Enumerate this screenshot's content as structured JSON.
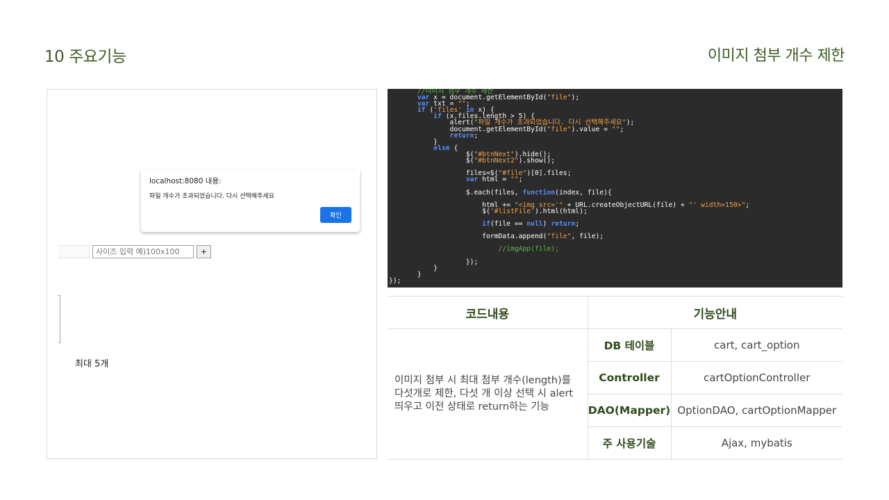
{
  "header": {
    "section_title": "10 주요기능",
    "feature_title": "이미지 첨부 개수 제한"
  },
  "screenshot": {
    "dialog_title": "localhost:8080 내용:",
    "dialog_message": "파일 개수가 초과되었습니다. 다시 선택해주세요",
    "dialog_ok": "확인",
    "size_placeholder": "사이즈 입력 예)100x100",
    "plus_label": "+",
    "max_count": "최대 5개"
  },
  "table": {
    "col_code": "코드내용",
    "col_func": "기능안내",
    "description": "이미지 첨부 시 최대 첨부 개수(length)를 다섯개로 제한, 다섯 개 이상 선택 시 alert 띄우고 이전 상태로 return하는 기능",
    "rows": [
      {
        "label": "DB 테이블",
        "value": "cart, cart_option"
      },
      {
        "label": "Controller",
        "value": "cartOptionController"
      },
      {
        "label": "DAO(Mapper)",
        "value": "OptionDAO, cartOptionMapper"
      },
      {
        "label": "주 사용기술",
        "value": "Ajax, mybatis"
      }
    ]
  },
  "colors": {
    "accent": "#3f5a24",
    "code_bg": "#2b2b2b",
    "button_blue": "#1a73e8"
  }
}
